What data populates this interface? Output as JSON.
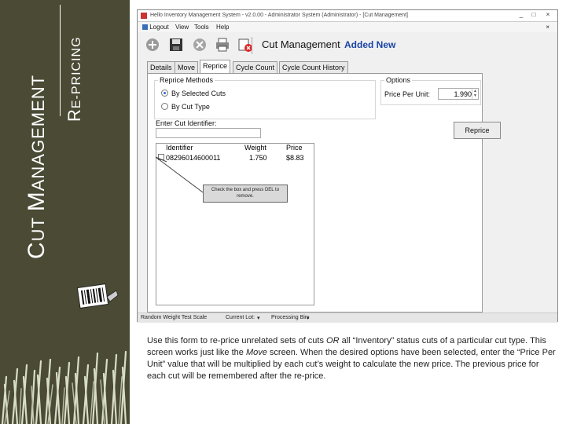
{
  "slide": {
    "title_main_first": "C",
    "title_main_rest": "UT ",
    "title_main_second_initial": "M",
    "title_main_second_rest": "ANAGEMENT",
    "title_sub_first": "R",
    "title_sub_rest": "E-PRICING",
    "description": {
      "part1": "Use this form to re-price unrelated sets of cuts ",
      "or_italic": "OR",
      "part2": " all “Inventory” status cuts of a particular cut type. This screen works just like the ",
      "move_italic": "Move",
      "part3": " screen. When the desired options have been selected, enter the “Price Per Unit” value that will be multiplied by each cut’s weight to calculate the new price. The previous price for each cut will be remembered after the re-price."
    }
  },
  "window": {
    "title": "Hello Inventory Management System - v2.0.00 - Administrator System (Administrator) - [Cut Management]",
    "controls": {
      "minimize": "_",
      "maximize": "□",
      "close": "×"
    },
    "menu": {
      "logout": "Logout",
      "view": "View",
      "tools": "Tools",
      "help": "Help",
      "close_child": "×"
    },
    "module_title": "Cut Management",
    "module_mode": "Added New",
    "tabs": [
      "Details",
      "Move",
      "Reprice",
      "Cycle Count",
      "Cycle Count History"
    ],
    "active_tab": "Reprice",
    "reprice_methods": {
      "title": "Reprice Methods",
      "options": [
        "By Selected Cuts",
        "By Cut Type"
      ],
      "selected_index": 0
    },
    "options": {
      "title": "Options",
      "price_label": "Price Per Unit:",
      "price_value": "1.990"
    },
    "cut_identifier_label": "Enter Cut Identifier:",
    "cut_identifier_value": "",
    "reprice_button": "Reprice",
    "grid": {
      "columns": [
        "Identifier",
        "Weight",
        "Price"
      ],
      "rows": [
        {
          "identifier": "08296014600011",
          "weight": "1.750",
          "price": "$8.83"
        }
      ]
    },
    "callout": "Check the box and press DEL to remove.",
    "status": {
      "scale": "Random Weight Test Scale",
      "lot": "Current Lot:",
      "bin": "Processing Bin:"
    }
  },
  "colors": {
    "sidebar": "#4a4a35",
    "mode_text": "#1b45a6"
  }
}
